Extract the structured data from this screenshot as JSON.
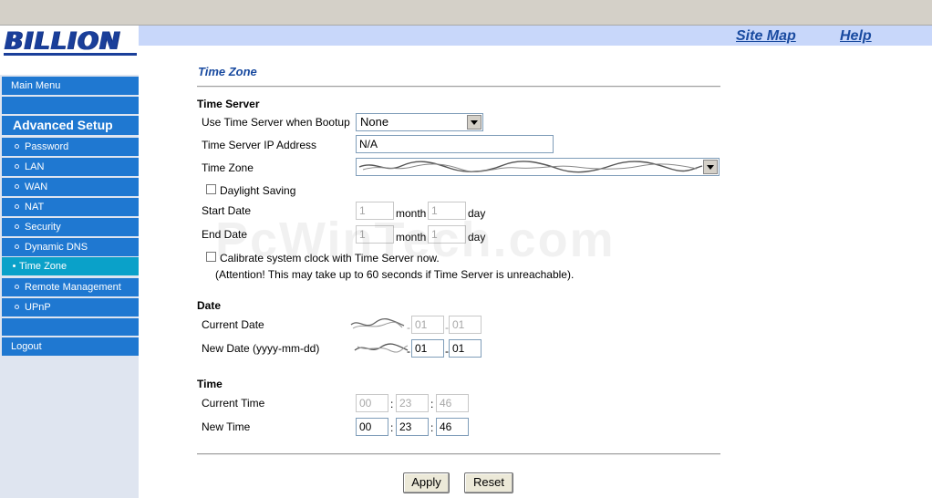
{
  "header": {
    "logo_text": "BILLION",
    "site_map": "Site Map",
    "help": "Help"
  },
  "sidebar": {
    "main_menu": "Main Menu",
    "advanced_setup": "Advanced Setup",
    "items": [
      {
        "label": "Password"
      },
      {
        "label": "LAN"
      },
      {
        "label": "WAN"
      },
      {
        "label": "NAT"
      },
      {
        "label": "Security"
      },
      {
        "label": "Dynamic DNS"
      },
      {
        "label": "Time Zone",
        "active": true
      },
      {
        "label": "Remote Management"
      },
      {
        "label": "UPnP"
      }
    ],
    "logout": "Logout"
  },
  "page": {
    "title": "Time Zone",
    "time_server": {
      "section": "Time Server",
      "use_label": "Use Time Server when Bootup",
      "use_value": "None",
      "ip_label": "Time Server IP Address",
      "ip_value": "N/A",
      "tz_label": "Time Zone",
      "daylight_label": "Daylight Saving",
      "start_label": "Start Date",
      "end_label": "End Date",
      "start_month": "1",
      "start_day": "1",
      "end_month": "1",
      "end_day": "1",
      "month_word": "month",
      "day_word": "day",
      "calibrate_label": "Calibrate system clock with Time Server now.",
      "attention": "(Attention! This may take up to 60 seconds if Time Server is unreachable)."
    },
    "date": {
      "section": "Date",
      "current_label": "Current Date",
      "current_month": "01",
      "current_day": "01",
      "new_label": "New Date (yyyy-mm-dd)",
      "new_month": "01",
      "new_day": "01"
    },
    "time": {
      "section": "Time",
      "current_label": "Current Time",
      "current_h": "00",
      "current_m": "23",
      "current_s": "46",
      "new_label": "New Time",
      "new_h": "00",
      "new_m": "23",
      "new_s": "46"
    },
    "apply": "Apply",
    "reset": "Reset"
  },
  "watermark": "PcWinTech.com",
  "colors": {
    "nav_bg": "#1f78d1",
    "nav_active": "#0aa1c9",
    "header_bar": "#c8d7fa",
    "title_blue": "#1a4ba0"
  }
}
